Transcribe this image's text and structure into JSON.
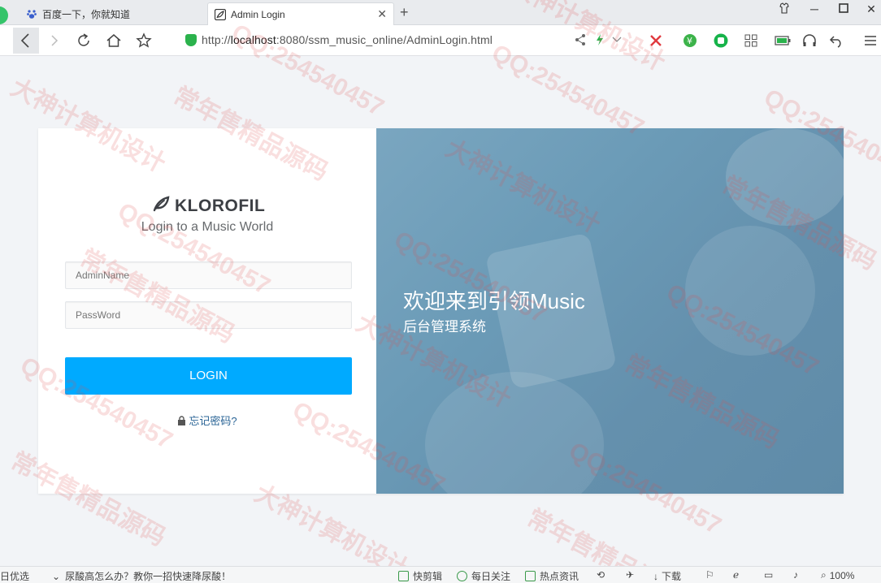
{
  "browser": {
    "tabs": [
      {
        "title": "百度一下，你就知道",
        "active": false
      },
      {
        "title": "Admin Login",
        "active": true
      }
    ],
    "url": {
      "prefix": "http://",
      "host": "localhost",
      "rest": ":8080/ssm_music_online/AdminLogin.html"
    },
    "zoom": "100%"
  },
  "login": {
    "brand": "KLOROFIL",
    "subtitle": "Login to a Music World",
    "admin_placeholder": "AdminName",
    "password_placeholder": "PassWord",
    "button_label": "LOGIN",
    "forgot_label": "忘记密码?"
  },
  "hero": {
    "title_cn": "欢迎来到引领",
    "title_en": "Music",
    "subtitle": "后台管理系统"
  },
  "watermarks": [
    "大神计算机设计",
    "常年售精品源码",
    "QQ:254540457"
  ],
  "statusbar": {
    "left_text": "日优选",
    "news": "尿酸高怎么办？教你一招快速降尿酸！",
    "items": [
      "快剪辑",
      "每日关注",
      "热点资讯",
      "下载"
    ],
    "zoom": "100%"
  }
}
